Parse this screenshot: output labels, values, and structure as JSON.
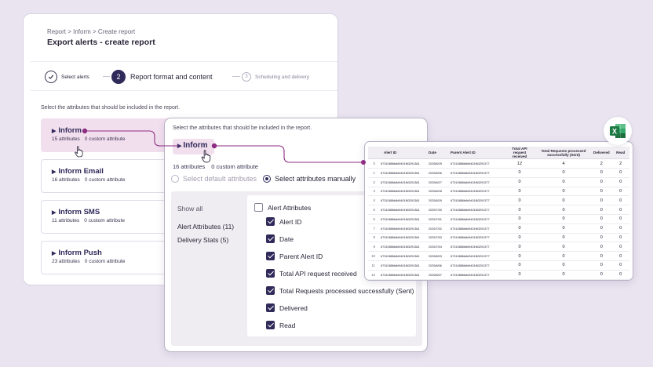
{
  "panel1": {
    "breadcrumb": "Report > Inform > Create report",
    "title": "Export alerts - create report",
    "steps": [
      {
        "label": "Select alerts",
        "icon": "check-icon"
      },
      {
        "number": "2",
        "label": "Report format and content"
      },
      {
        "number": "3",
        "label": "Scheduling and delivery"
      }
    ],
    "instruction": "Select the attributes that should be included in the report.",
    "categories": [
      {
        "name": "Inform",
        "attrs": "15 attributes",
        "custom": "0 custom attribute"
      },
      {
        "name": "Inform Email",
        "attrs": "16 attributes",
        "custom": "0 custom attribute"
      },
      {
        "name": "Inform SMS",
        "attrs": "11 attributes",
        "custom": "0 custom attribute"
      },
      {
        "name": "Inform Push",
        "attrs": "23 attributes",
        "custom": "0 custom attribute"
      }
    ]
  },
  "panel2": {
    "instruction": "Select the attributes that should be included in the report.",
    "category_name": "Inform",
    "attrs": "16 attributes",
    "custom": "0 custom attribute",
    "radio_default": "Select default attributes",
    "radio_manual": "Select attributes manually",
    "show_all": "Show all",
    "groups": [
      "Alert Attributes (11)",
      "Delivery Stats (5)"
    ],
    "group_header": "Alert Attributes",
    "checkboxes": [
      "Alert ID",
      "Date",
      "Parent Alert ID",
      "Total API request received",
      "Total Requests processed successfully (Sent)",
      "Delivered",
      "Read"
    ]
  },
  "sheet": {
    "headers": [
      "",
      "Alert ID",
      "Date",
      "Parent Alert ID",
      "Total API request received",
      "Total Requests processed successfully (Sent)",
      "Delivered",
      "Read"
    ],
    "rows": [
      [
        "0",
        "67310886b8d9401f63291381",
        "2025/6/29",
        "67310886b8d9401f63291377",
        "12",
        "4",
        "2",
        "2"
      ],
      [
        "1",
        "67310886b8d9401f63291381",
        "2025/6/06",
        "67310886b8d9401f63291377",
        "0",
        "0",
        "0",
        "0"
      ],
      [
        "2",
        "67310886b8d9401f63291381",
        "2025/6/27",
        "67310886b8d9401f63291377",
        "0",
        "0",
        "0",
        "0"
      ],
      [
        "3",
        "67310886b8d9401f63291381",
        "2025/6/28",
        "67310886b8d9401f63291377",
        "0",
        "0",
        "0",
        "0"
      ],
      [
        "4",
        "67310886b8d9401f63291381",
        "2025/6/29",
        "67310886b8d9401f63291377",
        "0",
        "0",
        "0",
        "0"
      ],
      [
        "5",
        "67310886b8d9401f63291381",
        "2025/7/30",
        "67310886b8d9401f63291377",
        "0",
        "0",
        "0",
        "0"
      ],
      [
        "6",
        "67310886b8d9401f63291381",
        "2025/7/01",
        "67310886b8d9401f63291377",
        "0",
        "0",
        "0",
        "0"
      ],
      [
        "7",
        "67310886b8d9401f63291381",
        "2025/7/02",
        "67310886b8d9401f63291377",
        "0",
        "0",
        "0",
        "0"
      ],
      [
        "8",
        "67310886b8d9401f63291381",
        "2025/7/03",
        "67310886b8d9401f63291377",
        "0",
        "0",
        "0",
        "0"
      ],
      [
        "9",
        "67310886b8d9401f63291381",
        "2025/7/04",
        "67310886b8d9401f63291377",
        "0",
        "0",
        "0",
        "0"
      ],
      [
        "10",
        "67310886b8d9401f63291381",
        "2025/6/03",
        "67310886b8d9401f63291377",
        "0",
        "0",
        "0",
        "0"
      ],
      [
        "11",
        "67310886b8d9401f63291381",
        "2025/6/06",
        "67310886b8d9401f63291377",
        "0",
        "0",
        "0",
        "0"
      ],
      [
        "12",
        "67310886b8d9401f63291381",
        "2025/6/07",
        "67310886b8d9401f63291377",
        "0",
        "0",
        "0",
        "0"
      ]
    ]
  },
  "excel_badge": {
    "letter": "X",
    "color": "#1f7a44"
  },
  "colors": {
    "accent": "#8e2d82",
    "primary": "#2f2a5a",
    "highlight": "#f2dfee",
    "background": "#e9e4f0"
  }
}
